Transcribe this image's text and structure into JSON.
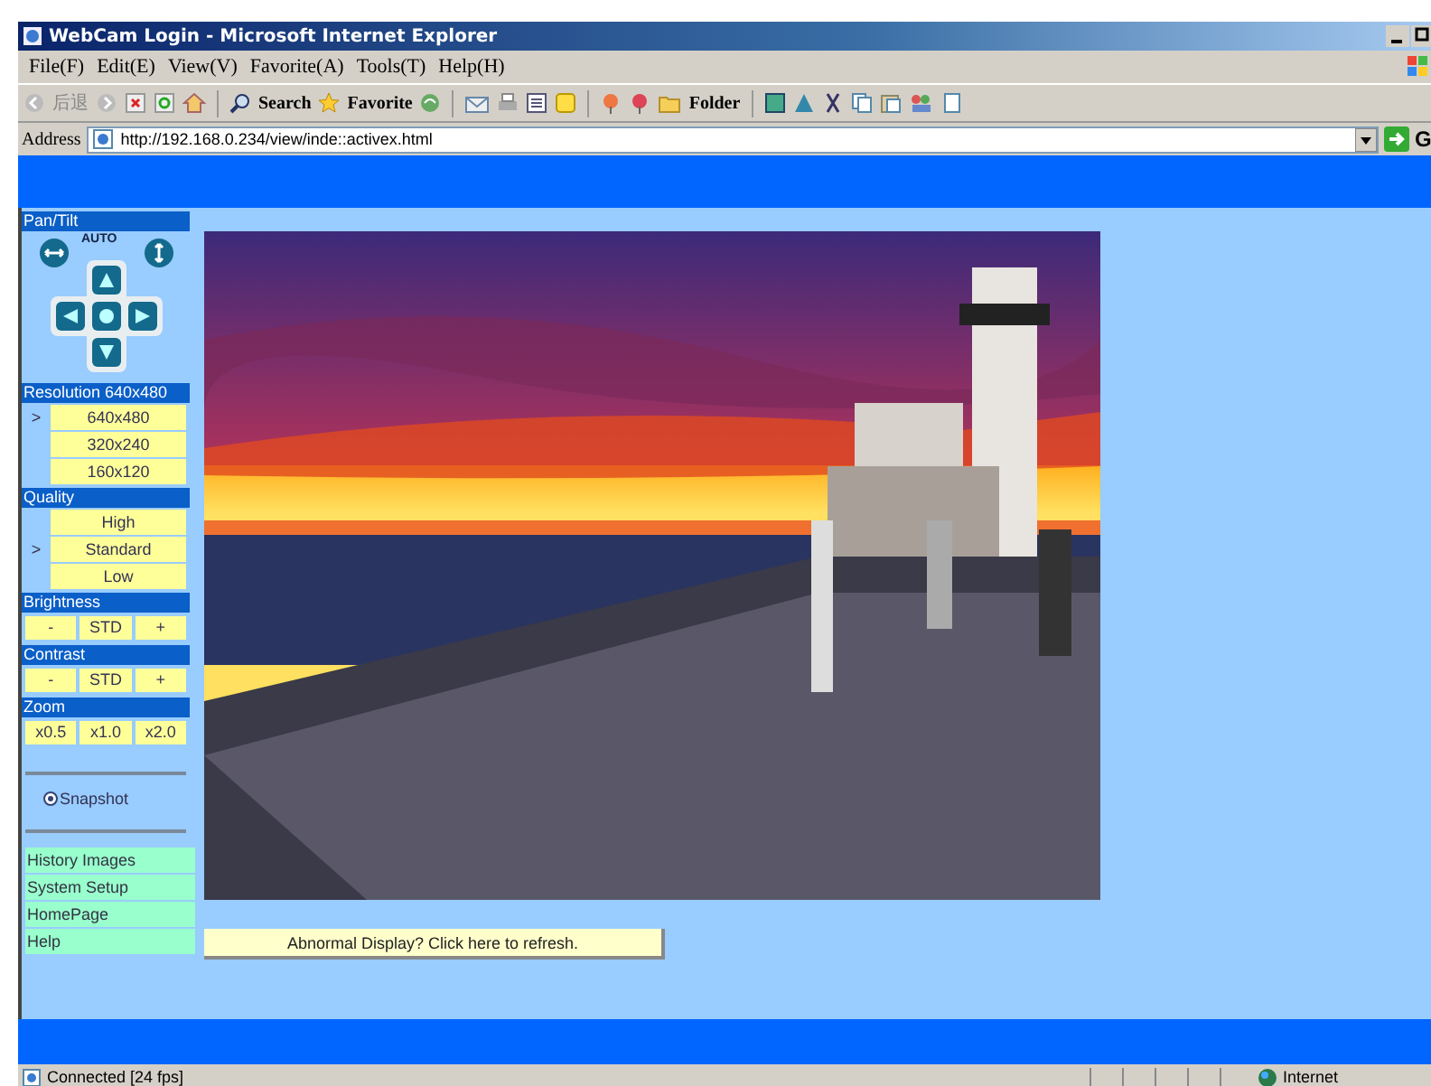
{
  "window": {
    "title": "WebCam Login - Microsoft Internet Explorer"
  },
  "menu": [
    "File(F)",
    "Edit(E)",
    "View(V)",
    "Favorite(A)",
    "Tools(T)",
    "Help(H)"
  ],
  "toolbar": {
    "back": "后退",
    "search": "Search",
    "favorite": "Favorite",
    "folder": "Folder"
  },
  "address": {
    "label": "Address",
    "url": "http://192.168.0.234/view/inde::activex.html",
    "go": "G"
  },
  "sidebar": {
    "pan_tilt": {
      "title": "Pan/Tilt",
      "auto": "AUTO"
    },
    "resolution": {
      "title": "Resolution 640x480",
      "marker": ">",
      "options": [
        {
          "label": "640x480",
          "selected": true
        },
        {
          "label": "320x240",
          "selected": false
        },
        {
          "label": "160x120",
          "selected": false
        }
      ]
    },
    "quality": {
      "title": "Quality",
      "marker": ">",
      "options": [
        {
          "label": "High",
          "selected": false
        },
        {
          "label": "Standard",
          "selected": true
        },
        {
          "label": "Low",
          "selected": false
        }
      ]
    },
    "brightness": {
      "title": "Brightness",
      "buttons": [
        "-",
        "STD",
        "+"
      ]
    },
    "contrast": {
      "title": "Contrast",
      "buttons": [
        "-",
        "STD",
        "+"
      ]
    },
    "zoom": {
      "title": "Zoom",
      "buttons": [
        "x0.5",
        "x1.0",
        "x2.0"
      ]
    },
    "snapshot": "Snapshot",
    "links": [
      "History Images",
      "System Setup",
      "HomePage",
      "Help"
    ]
  },
  "refresh_button": "Abnormal Display? Click here to refresh.",
  "status_bar": {
    "text": "Connected [24 fps]",
    "zone": "Internet"
  }
}
